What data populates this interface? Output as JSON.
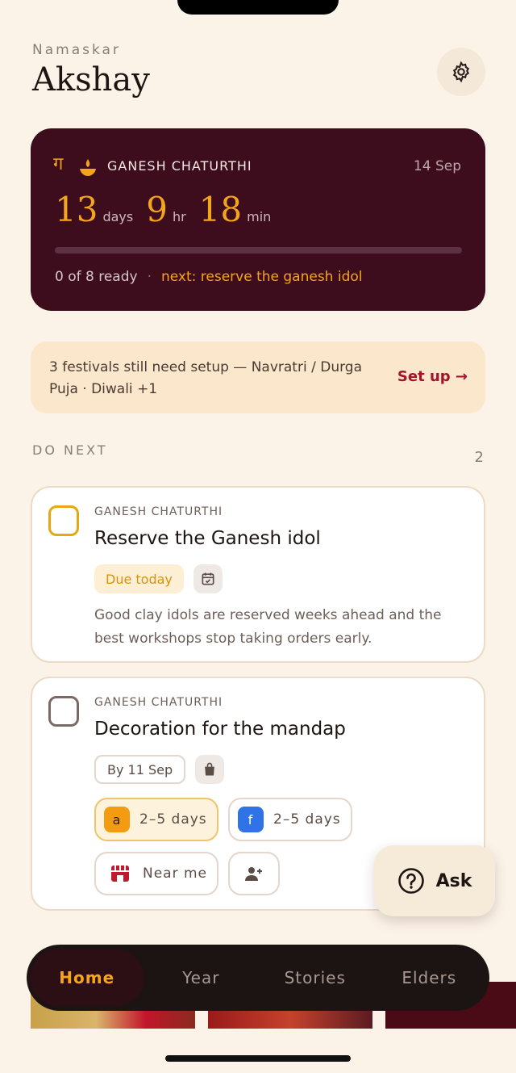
{
  "header": {
    "greeting": "Namaskar",
    "name": "Akshay",
    "settings_icon": "gear-icon"
  },
  "hero": {
    "glyph": "ग",
    "festival": "GANESH CHATURTHI",
    "date": "14 Sep",
    "countdown": {
      "days": "13",
      "days_unit": "days",
      "hours": "9",
      "hours_unit": "hr",
      "minutes": "18",
      "minutes_unit": "min"
    },
    "progress": {
      "ready": 0,
      "total": 8
    },
    "ready_text": "0 of 8 ready",
    "separator": "·",
    "next_text": "next: reserve the ganesh idol",
    "accent_color": "#f3a61c",
    "background_color": "#3d0c1d"
  },
  "setup_banner": {
    "text": "3 festivals still need setup — Navratri / Durga Puja · Diwali +1",
    "link": "Set up →"
  },
  "do_next": {
    "title": "DO NEXT",
    "count": "2",
    "tasks": [
      {
        "festival": "GANESH CHATURTHI",
        "title": "Reserve the Ganesh idol",
        "due": "Due today",
        "type_icon": "calendar-check-icon",
        "description": "Good clay idols are reserved weeks ahead and the best workshops stop taking orders early."
      },
      {
        "festival": "GANESH CHATURTHI",
        "title": "Decoration for the mandap",
        "due": "By 11 Sep",
        "type_icon": "shopping-bag-icon",
        "options": [
          {
            "badge": "a",
            "label": "2–5 days",
            "badge_color": "#f39c12"
          },
          {
            "badge": "f",
            "label": "2–5 days",
            "badge_color": "#2f73e6"
          }
        ],
        "near_me": "Near me",
        "store_icon": "store-icon",
        "add_person_icon": "add-person-icon"
      }
    ]
  },
  "ask_button": {
    "label": "Ask",
    "icon": "question-circle-icon"
  },
  "nav": {
    "items": [
      {
        "label": "Home",
        "active": true
      },
      {
        "label": "Year"
      },
      {
        "label": "Stories"
      },
      {
        "label": "Elders"
      }
    ]
  }
}
